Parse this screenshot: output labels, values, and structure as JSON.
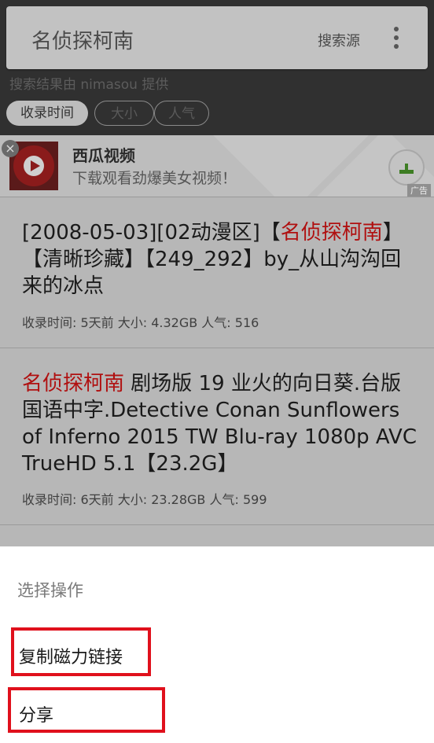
{
  "search": {
    "query": "名侦探柯南",
    "source_label": "搜索源"
  },
  "provider_text": "搜索结果由 nimasou 提供",
  "sort_chips": [
    {
      "label": "收录时间",
      "active": true
    },
    {
      "label": "大小",
      "active": false
    },
    {
      "label": "人气",
      "active": false
    }
  ],
  "ad": {
    "close": "×",
    "title": "西瓜视频",
    "description": "下载观看劲爆美女视频！",
    "tag": "广告",
    "icons": {
      "logo": "watermelon-video-logo",
      "download": "download-icon",
      "close": "close-icon"
    }
  },
  "results": [
    {
      "title_prefix": "[2008-05-03][02动漫区]【",
      "title_highlight": "名侦探柯南",
      "title_suffix": "】【清晰珍藏】【249_292】by_从山沟沟回来的冰点",
      "meta": "收录时间: 5天前 大小: 4.32GB 人气: 516"
    },
    {
      "title_prefix": "",
      "title_highlight": "名侦探柯南",
      "title_suffix": " 剧场版 19 业火的向日葵.台版国语中字.Detective Conan Sunflowers of Inferno 2015 TW Blu-ray 1080p AVC TrueHD 5.1【23.2G】",
      "meta": "收录时间: 6天前 大小: 23.28GB 人气: 599"
    }
  ],
  "action_sheet": {
    "title": "选择操作",
    "options": [
      "复制磁力链接",
      "分享"
    ]
  },
  "colors": {
    "highlight": "#b01010",
    "annotation_box": "#e0101c"
  }
}
